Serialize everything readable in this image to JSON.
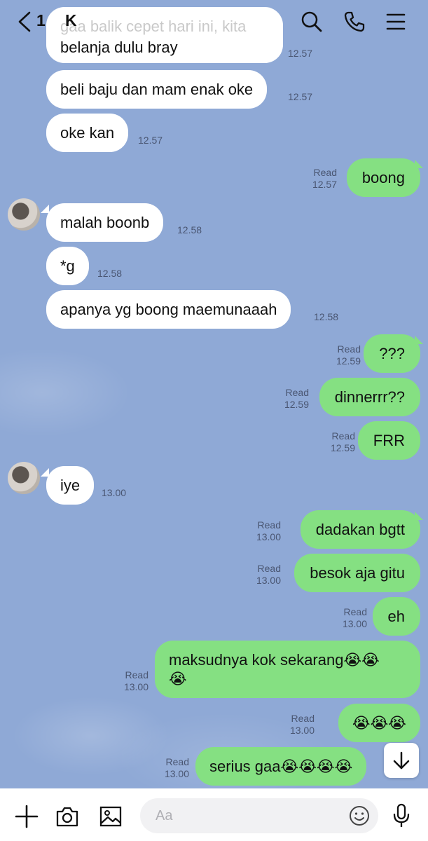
{
  "header": {
    "back_count": "1",
    "contact_name": "K"
  },
  "top_clipped": {
    "line1": "gaa balik cepet hari ini, kita",
    "line2": "belanja dulu bray",
    "time": "12.57"
  },
  "messages": [
    {
      "text": "beli baju dan mam enak oke",
      "time": "12.57"
    },
    {
      "text": "oke kan",
      "time": "12.57"
    },
    {
      "text": "boong",
      "read": "Read",
      "time": "12.57"
    },
    {
      "text": "malah boonb",
      "time": "12.58"
    },
    {
      "text": "*g",
      "time": "12.58"
    },
    {
      "text": "apanya yg boong maemunaaah",
      "time": "12.58"
    },
    {
      "text": "???",
      "read": "Read",
      "time": "12.59"
    },
    {
      "text": "dinnerrr??",
      "read": "Read",
      "time": "12.59"
    },
    {
      "text": "FRR",
      "read": "Read",
      "time": "12.59"
    },
    {
      "text": "iye",
      "time": "13.00"
    },
    {
      "text": "dadakan bgtt",
      "read": "Read",
      "time": "13.00"
    },
    {
      "text": "besok aja gitu",
      "read": "Read",
      "time": "13.00"
    },
    {
      "text": "eh",
      "read": "Read",
      "time": "13.00"
    },
    {
      "text": "maksudnya kok sekarang😭😭",
      "text2": "😭",
      "read": "Read",
      "time": "13.00"
    },
    {
      "text": "😭😭😭",
      "read": "Read",
      "time": "13.00"
    },
    {
      "text": "serius gaa😭😭😭😭",
      "read": "Read",
      "time": "13.00"
    }
  ],
  "input": {
    "placeholder": "Aa"
  },
  "icons": {
    "back": "chevron-left-icon",
    "search": "search-icon",
    "call": "phone-icon",
    "menu": "menu-icon",
    "add": "plus-icon",
    "camera": "camera-icon",
    "gallery": "image-icon",
    "emoji": "smiley-icon",
    "mic": "microphone-icon",
    "scroll": "arrow-down-icon"
  },
  "colors": {
    "background": "#8fa9d6",
    "incoming_bubble": "#ffffff",
    "outgoing_bubble": "#85e082"
  }
}
